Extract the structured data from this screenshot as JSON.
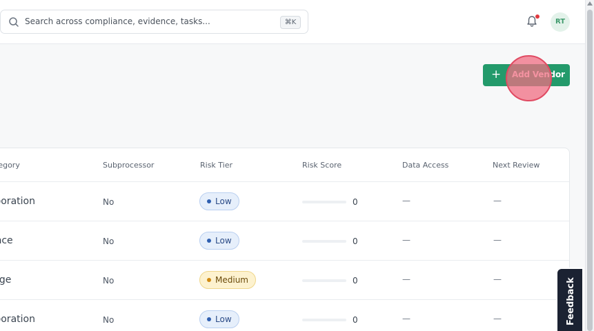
{
  "search": {
    "placeholder": "Search across compliance, evidence, tasks...",
    "shortcut": "⌘K"
  },
  "header": {
    "avatar_initials": "RT",
    "notification_indicator": "bell-icon"
  },
  "actions": {
    "add_vendor_label": "Add Vendor",
    "add_vendor_icon": "plus-icon"
  },
  "table": {
    "columns": [
      "tegory",
      "Subprocessor",
      "Risk Tier",
      "Risk Score",
      "Data Access",
      "Next Review"
    ],
    "rows": [
      {
        "category": "llaboration",
        "subprocessor": "No",
        "risk_tier": "Low",
        "risk_tier_level": "low",
        "risk_score": "0",
        "risk_score_fraction": 0,
        "data_access": "—",
        "next_review": "—"
      },
      {
        "category": "nance",
        "subprocessor": "No",
        "risk_tier": "Low",
        "risk_tier_level": "low",
        "risk_score": "0",
        "risk_score_fraction": 0,
        "data_access": "—",
        "next_review": "—"
      },
      {
        "category": "orage",
        "subprocessor": "No",
        "risk_tier": "Medium",
        "risk_tier_level": "medium",
        "risk_score": "0",
        "risk_score_fraction": 0,
        "data_access": "—",
        "next_review": "—"
      },
      {
        "category": "llaboration",
        "subprocessor": "No",
        "risk_tier": "Low",
        "risk_tier_level": "low",
        "risk_score": "0",
        "risk_score_fraction": 0,
        "data_access": "—",
        "next_review": "—"
      }
    ]
  },
  "feedback": {
    "label": "Feedback"
  },
  "colors": {
    "accent": "#239a6b",
    "notification": "#e0393e",
    "low_badge": "#e6effb",
    "medium_badge": "#fdf2cf",
    "feedback_bg": "#1b2232"
  }
}
